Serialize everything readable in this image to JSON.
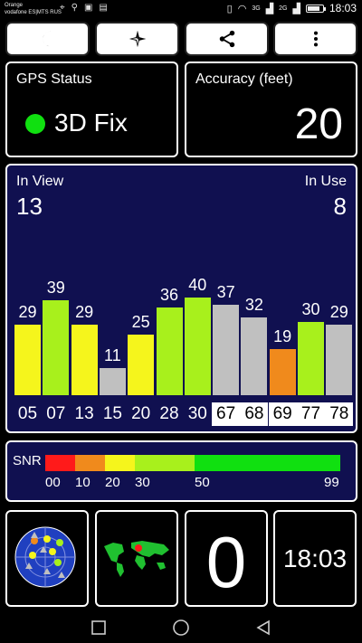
{
  "status_bar": {
    "carrier_line1": "Orange",
    "carrier_line2": "vodafone ES|MTS RUS",
    "network_3g": "3G",
    "network_2g": "2G",
    "time": "18:03"
  },
  "toolbar": {
    "buttons": [
      {
        "icon": "moon-icon"
      },
      {
        "icon": "compass-icon"
      },
      {
        "icon": "share-icon"
      },
      {
        "icon": "more-vert-icon"
      }
    ]
  },
  "gps_status": {
    "label": "GPS Status",
    "fix": "3D Fix",
    "fix_color": "#10e010"
  },
  "accuracy": {
    "label": "Accuracy (feet)",
    "value": "20"
  },
  "satellites": {
    "in_view_label": "In View",
    "in_view": "13",
    "in_use_label": "In Use",
    "in_use": "8",
    "bars": [
      {
        "prn": "05",
        "snr": 29,
        "color": "#f5f51c",
        "highlight": false
      },
      {
        "prn": "07",
        "snr": 39,
        "color": "#a8f01c",
        "highlight": false
      },
      {
        "prn": "13",
        "snr": 29,
        "color": "#f5f51c",
        "highlight": false
      },
      {
        "prn": "15",
        "snr": 11,
        "color": "#c0c0c0",
        "highlight": false
      },
      {
        "prn": "20",
        "snr": 25,
        "color": "#f5f51c",
        "highlight": false
      },
      {
        "prn": "28",
        "snr": 36,
        "color": "#a8f01c",
        "highlight": false
      },
      {
        "prn": "30",
        "snr": 40,
        "color": "#a8f01c",
        "highlight": false
      },
      {
        "prn": "67",
        "snr": 37,
        "color": "#c0c0c0",
        "highlight": true
      },
      {
        "prn": "68",
        "snr": 32,
        "color": "#c0c0c0",
        "highlight": true
      },
      {
        "prn": "69",
        "snr": 19,
        "color": "#f08a1c",
        "highlight": true
      },
      {
        "prn": "77",
        "snr": 30,
        "color": "#a8f01c",
        "highlight": true
      },
      {
        "prn": "78",
        "snr": 29,
        "color": "#c0c0c0",
        "highlight": true
      }
    ]
  },
  "snr_scale": {
    "label": "SNR",
    "ticks": [
      "00",
      "10",
      "20",
      "30",
      "50",
      "99"
    ],
    "segments": [
      {
        "color": "#ff1a1a"
      },
      {
        "color": "#f08a1c"
      },
      {
        "color": "#f5f51c"
      },
      {
        "color": "#a8f01c"
      },
      {
        "color": "#10e010"
      }
    ]
  },
  "tiles": {
    "radar_icon": "sky-plot-icon",
    "map_icon": "world-map-icon",
    "count": "0",
    "clock": "18:03"
  },
  "nav": {
    "recent_icon": "square-icon",
    "home_icon": "circle-icon",
    "back_icon": "triangle-back-icon"
  }
}
